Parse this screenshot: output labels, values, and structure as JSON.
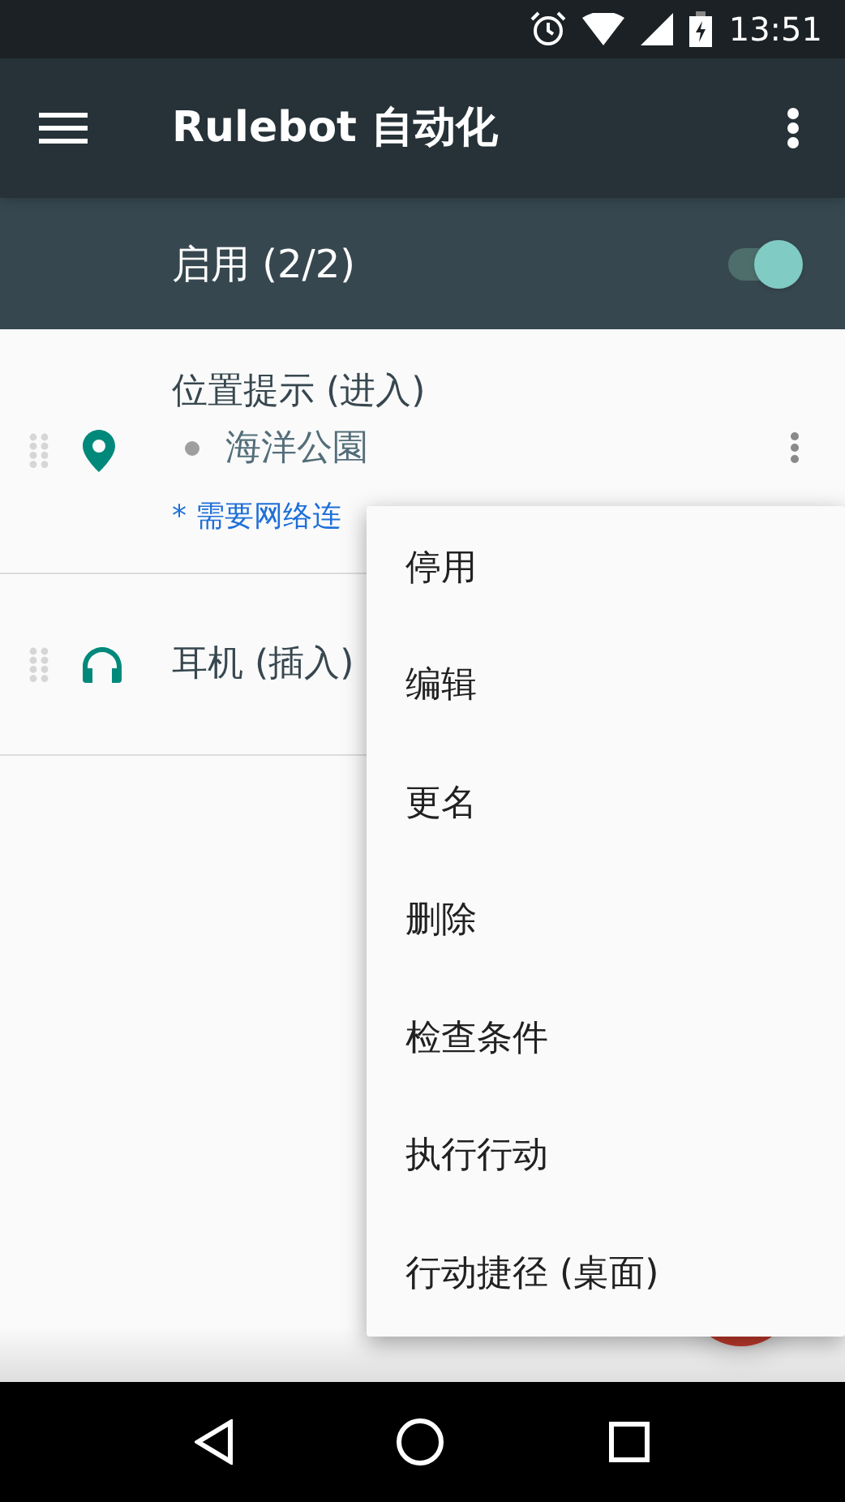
{
  "status_bar": {
    "time": "13:51"
  },
  "toolbar": {
    "title": "Rulebot 自动化"
  },
  "section": {
    "label": "启用 (2/2)",
    "on": true
  },
  "rules": [
    {
      "kind": "location",
      "title": "位置提示 (进入)",
      "detail": "海洋公園",
      "note": "* 需要网络连"
    },
    {
      "kind": "headphones",
      "title": "耳机 (插入)"
    }
  ],
  "menu": [
    "停用",
    "编辑",
    "更名",
    "删除",
    "检查条件",
    "执行行动",
    "行动捷径 (桌面)"
  ]
}
